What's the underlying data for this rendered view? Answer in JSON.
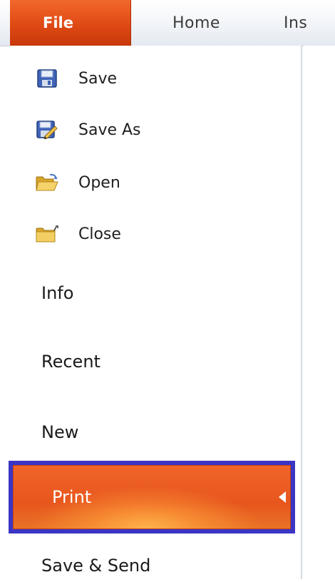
{
  "tabs": {
    "file": "File",
    "home": "Home",
    "insert_partial": "Ins"
  },
  "commands": [
    {
      "label": "Save",
      "icon": "save-icon"
    },
    {
      "label": "Save As",
      "icon": "save-as-icon"
    },
    {
      "label": "Open",
      "icon": "open-folder-icon"
    },
    {
      "label": "Close",
      "icon": "close-folder-icon"
    }
  ],
  "nav": {
    "info": "Info",
    "recent": "Recent",
    "new": "New",
    "print": "Print",
    "save_send": "Save & Send"
  },
  "colors": {
    "file_tab": "#df4a14",
    "selected_item": "#e7561d",
    "highlight_border": "#3b35c4"
  }
}
